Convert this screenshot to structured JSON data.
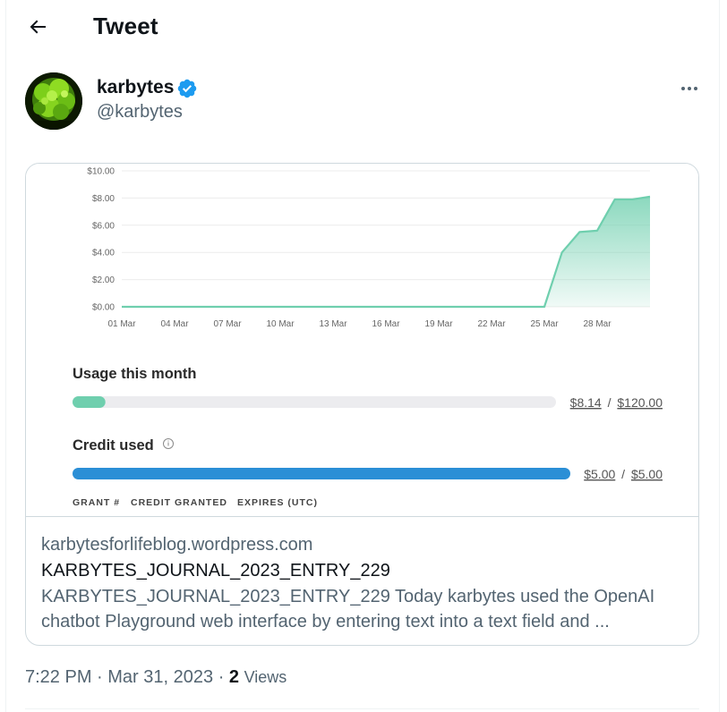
{
  "header": {
    "title": "Tweet",
    "back_icon": "arrow-left-icon"
  },
  "author": {
    "name": "karbytes",
    "handle": "@karbytes",
    "verified": true,
    "verified_color": "#1d9bf0"
  },
  "card": {
    "screenshot": {
      "chart_data": {
        "type": "area",
        "x": [
          "01 Mar",
          "04 Mar",
          "07 Mar",
          "10 Mar",
          "13 Mar",
          "16 Mar",
          "19 Mar",
          "22 Mar",
          "25 Mar",
          "28 Mar"
        ],
        "y_ticks": [
          "$10.00",
          "$8.00",
          "$6.00",
          "$4.00",
          "$2.00",
          "$0.00"
        ],
        "ylim": [
          0,
          10
        ],
        "points": [
          [
            1,
            0
          ],
          [
            2,
            0
          ],
          [
            3,
            0
          ],
          [
            4,
            0
          ],
          [
            5,
            0
          ],
          [
            6,
            0
          ],
          [
            7,
            0
          ],
          [
            8,
            0
          ],
          [
            9,
            0
          ],
          [
            10,
            0
          ],
          [
            11,
            0
          ],
          [
            12,
            0
          ],
          [
            13,
            0
          ],
          [
            14,
            0
          ],
          [
            15,
            0
          ],
          [
            16,
            0
          ],
          [
            17,
            0
          ],
          [
            18,
            0
          ],
          [
            19,
            0
          ],
          [
            20,
            0
          ],
          [
            21,
            0
          ],
          [
            22,
            0
          ],
          [
            23,
            0
          ],
          [
            24,
            0
          ],
          [
            25,
            0
          ],
          [
            26,
            4.0
          ],
          [
            27,
            5.5
          ],
          [
            28,
            5.6
          ],
          [
            29,
            7.9
          ],
          [
            30,
            7.9
          ],
          [
            31,
            8.1
          ]
        ],
        "color": "#6fcfae"
      },
      "usage": {
        "label": "Usage this month",
        "value": "$8.14",
        "limit": "$120.00",
        "separator": "/",
        "fraction": 0.068,
        "color": "#6fcfae"
      },
      "credit": {
        "label": "Credit used",
        "value": "$5.00",
        "limit": "$5.00",
        "separator": "/",
        "fraction": 1.0,
        "color": "#2b8fd6"
      },
      "columns": [
        "GRANT #",
        "CREDIT GRANTED",
        "EXPIRES (UTC)"
      ]
    },
    "domain": "karbytesforlifeblog.wordpress.com",
    "title": "KARBYTES_JOURNAL_2023_ENTRY_229",
    "description": "KARBYTES_JOURNAL_2023_ENTRY_229 Today karbytes used the OpenAI chatbot Playground web interface by entering text into a text field and ..."
  },
  "meta": {
    "time": "7:22 PM",
    "date": "Mar 31, 2023",
    "views_count": "2",
    "views_label": "Views"
  }
}
